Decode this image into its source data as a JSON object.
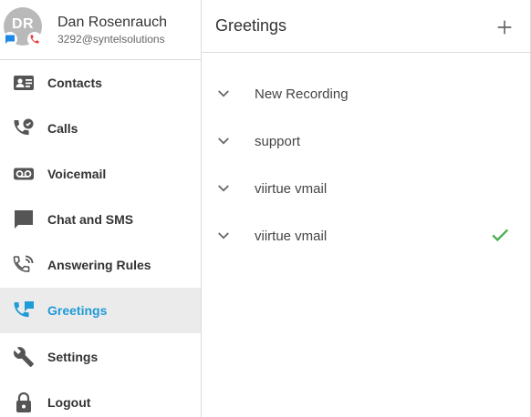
{
  "profile": {
    "initials": "DR",
    "name": "Dan Rosenrauch",
    "extension": "3292@syntelsolutions",
    "chat_badge_color": "#1e88e5",
    "phone_badge_color": "#e53935"
  },
  "nav": {
    "items": [
      {
        "label": "Contacts",
        "icon": "contacts-icon"
      },
      {
        "label": "Calls",
        "icon": "calls-icon"
      },
      {
        "label": "Voicemail",
        "icon": "voicemail-icon"
      },
      {
        "label": "Chat and SMS",
        "icon": "chat-icon"
      },
      {
        "label": "Answering Rules",
        "icon": "answering-rules-icon"
      },
      {
        "label": "Greetings",
        "icon": "greetings-icon",
        "active": true
      },
      {
        "label": "Settings",
        "icon": "wrench-icon"
      },
      {
        "label": "Logout",
        "icon": "lock-icon"
      }
    ]
  },
  "main": {
    "title": "Greetings",
    "add_icon": "plus-icon",
    "greetings": [
      {
        "label": "New Recording",
        "selected": false
      },
      {
        "label": "support",
        "selected": false
      },
      {
        "label": "viirtue vmail",
        "selected": false
      },
      {
        "label": "viirtue vmail",
        "selected": true
      }
    ]
  },
  "colors": {
    "accent": "#1f9bd8",
    "active_bg": "#ebebeb",
    "check": "#4caf50",
    "icon": "#555555"
  }
}
